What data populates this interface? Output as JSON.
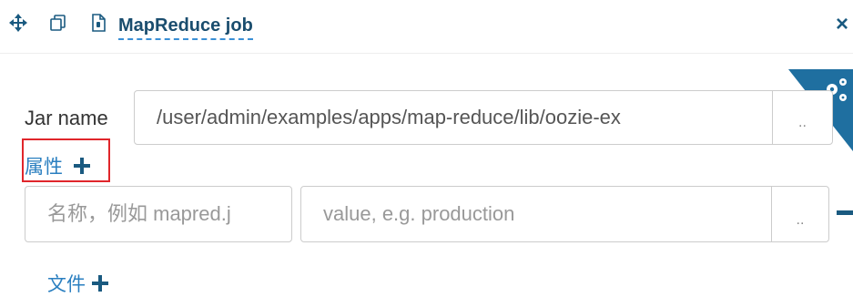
{
  "header": {
    "move_icon": "arrows-move-icon",
    "copy_icon": "copy-icon",
    "doc_icon": "document-icon",
    "title": "MapReduce job",
    "close_label": "×",
    "corner_icon": "gears-icon"
  },
  "jar": {
    "label": "Jar name",
    "value": "/user/admin/examples/apps/map-reduce/lib/oozie-ex",
    "browse_label": ".."
  },
  "properties": {
    "label": "属性",
    "add_icon": "plus-icon",
    "name_placeholder": "名称，例如 mapred.j",
    "value_placeholder": "value, e.g. production",
    "browse_label": "..",
    "remove_icon": "minus-icon"
  },
  "files": {
    "label": "文件",
    "add_icon": "plus-icon"
  },
  "colors": {
    "accent": "#2a7fc0",
    "dark_icon": "#1a5a80",
    "highlight_box": "#e0262b",
    "corner": "#1f6fa0"
  }
}
